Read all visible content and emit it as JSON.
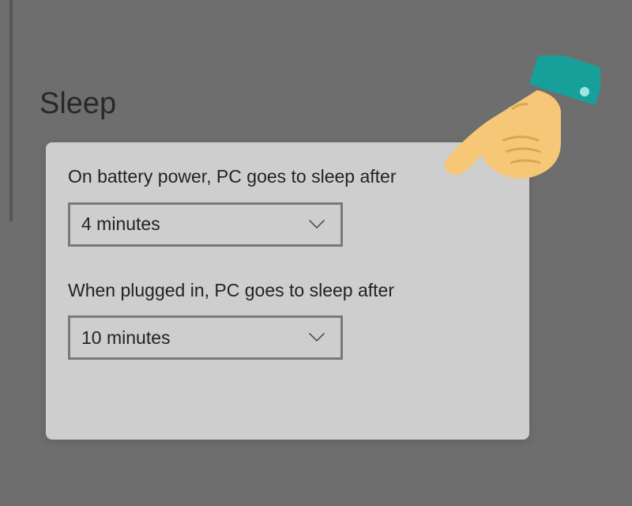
{
  "section": {
    "heading": "Sleep"
  },
  "settings": {
    "battery": {
      "label": "On battery power, PC goes to sleep after",
      "value": "4 minutes"
    },
    "plugged": {
      "label": "When plugged in, PC goes to sleep after",
      "value": "10 minutes"
    }
  }
}
